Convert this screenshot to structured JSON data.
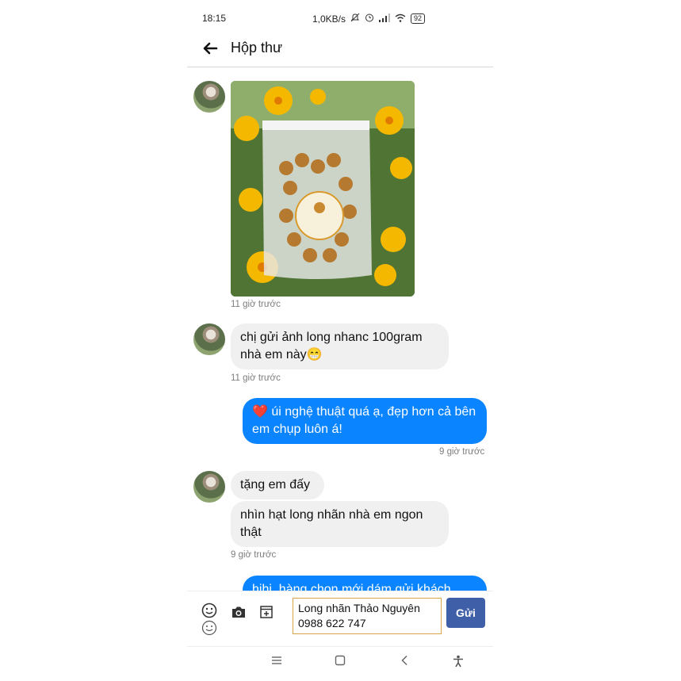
{
  "status": {
    "time": "18:15",
    "net_speed": "1,0KB/s",
    "battery": "92"
  },
  "header": {
    "title": "Hộp thư",
    "back_icon": "arrow-left-icon"
  },
  "messages": [
    {
      "type": "image",
      "timestamp": "11 giờ trước"
    },
    {
      "type": "incoming",
      "text": "chị gửi ảnh long nhanc 100gram nhà em này😁",
      "timestamp": "11 giờ trước"
    },
    {
      "type": "outgoing",
      "text": "❤️ úi nghệ thuật quá ạ, đẹp hơn cả bên em chụp luôn á!",
      "timestamp": "9 giờ trước"
    },
    {
      "type": "incoming",
      "text": "tặng em đấy"
    },
    {
      "type": "incoming",
      "text": "nhìn hạt long nhãn nhà em ngon thật",
      "timestamp": "9 giờ trước"
    },
    {
      "type": "outgoing",
      "text": "hihi, hàng chọn mới dám gửi khách"
    }
  ],
  "composer": {
    "input_value": "Long nhãn Thảo Nguyên\n0988 622 747",
    "send_label": "Gửi",
    "icons": [
      "emoji-icon",
      "sticker-icon",
      "camera-icon",
      "add-icon"
    ]
  },
  "colors": {
    "outgoing_bubble": "#0a84ff",
    "incoming_bubble": "#f0f0f0",
    "send_button": "#3f5fa8"
  }
}
